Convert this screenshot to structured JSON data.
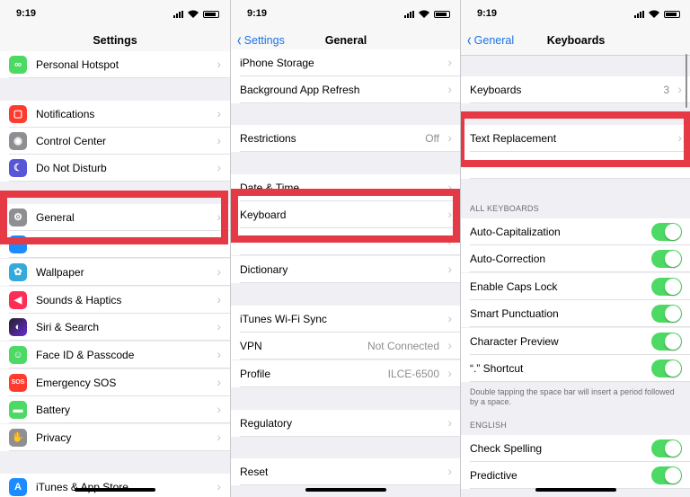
{
  "status": {
    "time": "9:19"
  },
  "panel1": {
    "title": "Settings",
    "rows": [
      {
        "label": "Personal Hotspot",
        "icon": "hotspot-icon",
        "color": "#4cd964"
      },
      {
        "label": "Notifications",
        "icon": "notifications-icon",
        "color": "#ff3b30"
      },
      {
        "label": "Control Center",
        "icon": "control-center-icon",
        "color": "#8e8e93"
      },
      {
        "label": "Do Not Disturb",
        "icon": "moon-icon",
        "color": "#5856d6"
      },
      {
        "label": "General",
        "icon": "gear-icon",
        "color": "#8e8e93"
      },
      {
        "label": "Wallpaper",
        "icon": "wallpaper-icon",
        "color": "#34aadc"
      },
      {
        "label": "Sounds & Haptics",
        "icon": "speaker-icon",
        "color": "#ff2d55"
      },
      {
        "label": "Siri & Search",
        "icon": "siri-icon",
        "color": "#222222"
      },
      {
        "label": "Face ID & Passcode",
        "icon": "face-id-icon",
        "color": "#4cd964"
      },
      {
        "label": "Emergency SOS",
        "icon": "sos-icon",
        "color": "#ff3b30",
        "glyph": "SOS"
      },
      {
        "label": "Battery",
        "icon": "battery-icon",
        "color": "#4cd964"
      },
      {
        "label": "Privacy",
        "icon": "hand-icon",
        "color": "#8e8e93"
      },
      {
        "label": "iTunes & App Store",
        "icon": "app-store-icon",
        "color": "#1a8cff"
      }
    ]
  },
  "panel2": {
    "back": "Settings",
    "title": "General",
    "rows": [
      {
        "label": "iPhone Storage"
      },
      {
        "label": "Background App Refresh"
      },
      {
        "label": "Restrictions",
        "value": "Off"
      },
      {
        "label": "Date & Time"
      },
      {
        "label": "Keyboard"
      },
      {
        "label": "Dictionary"
      },
      {
        "label": "iTunes Wi-Fi Sync"
      },
      {
        "label": "VPN",
        "value": "Not Connected"
      },
      {
        "label": "Profile",
        "value": "ILCE-6500"
      },
      {
        "label": "Regulatory"
      },
      {
        "label": "Reset"
      }
    ]
  },
  "panel3": {
    "back": "General",
    "title": "Keyboards",
    "keyboards_row": {
      "label": "Keyboards",
      "value": "3"
    },
    "text_replacement": "Text Replacement",
    "section_all": "ALL KEYBOARDS",
    "toggles": [
      {
        "label": "Auto-Capitalization",
        "on": true
      },
      {
        "label": "Auto-Correction",
        "on": true
      },
      {
        "label": "Enable Caps Lock",
        "on": true
      },
      {
        "label": "Smart Punctuation",
        "on": true
      },
      {
        "label": "Character Preview",
        "on": true
      },
      {
        "label": "“.” Shortcut",
        "on": true
      }
    ],
    "footnote": "Double tapping the space bar will insert a period followed by a space.",
    "section_english": "ENGLISH",
    "english_toggles": [
      {
        "label": "Check Spelling",
        "on": true
      },
      {
        "label": "Predictive",
        "on": true
      }
    ]
  },
  "colors": {
    "accent": "#1a73e8",
    "highlight": "#e53946",
    "toggle_on": "#4cd964"
  }
}
